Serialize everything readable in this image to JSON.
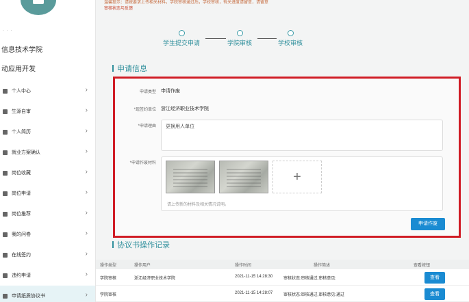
{
  "sidebar": {
    "dots": "· · ·",
    "school": "信息技术学院",
    "major": "动应用开发",
    "items": [
      {
        "label": "个人中心"
      },
      {
        "label": "生源自审"
      },
      {
        "label": "个人简历"
      },
      {
        "label": "就业方案确认"
      },
      {
        "label": "岗位收藏"
      },
      {
        "label": "岗位申请"
      },
      {
        "label": "岗位推荐"
      },
      {
        "label": "我的问卷"
      },
      {
        "label": "在线签约"
      },
      {
        "label": "违约申请"
      },
      {
        "label": "申请纸质协议书"
      }
    ],
    "chevron": "›"
  },
  "notice": {
    "line1": "温馨提示：请按要求上传相关材料，学院审核通过后，学校审核，有关进度请留意，请留意",
    "line2": "审核状态与反馈"
  },
  "steps": [
    {
      "label": "学生提交申请"
    },
    {
      "label": "学院审核"
    },
    {
      "label": "学校审核"
    }
  ],
  "section_apply": {
    "title": "申请信息"
  },
  "form": {
    "type_label": "申请类型",
    "type_value": "申请作废",
    "unit_label": "*现签约单位",
    "unit_value": "浙江经济职业技术学院",
    "reason_label": "*申请理由",
    "reason_value": "更换用人单位",
    "material_label": "*申请作废材料",
    "upload_hint": "请上传新的材料及相关情况说明。",
    "add_symbol": "+",
    "submit_label": "申请作废"
  },
  "section_records": {
    "title": "协议书操作记录"
  },
  "records": {
    "headers": [
      "操作类型",
      "操作用户",
      "操作时间",
      "操作简述",
      "查看按钮"
    ],
    "rows": [
      {
        "type": "学院审核",
        "user": "浙江经济职业技术学院",
        "time": "2021-11-15 14:28:30",
        "desc": "审核状态:审核通过,审核意见:",
        "action": "查看"
      },
      {
        "type": "学院审核",
        "user": "",
        "time": "2021-11-15 14:28:07",
        "desc": "审核状态:审核通过,审核意见:通过",
        "action": "查看"
      }
    ]
  },
  "colors": {
    "accent": "#2f8f9c",
    "button": "#1a8bd2",
    "highlight_border": "#d01c25"
  }
}
